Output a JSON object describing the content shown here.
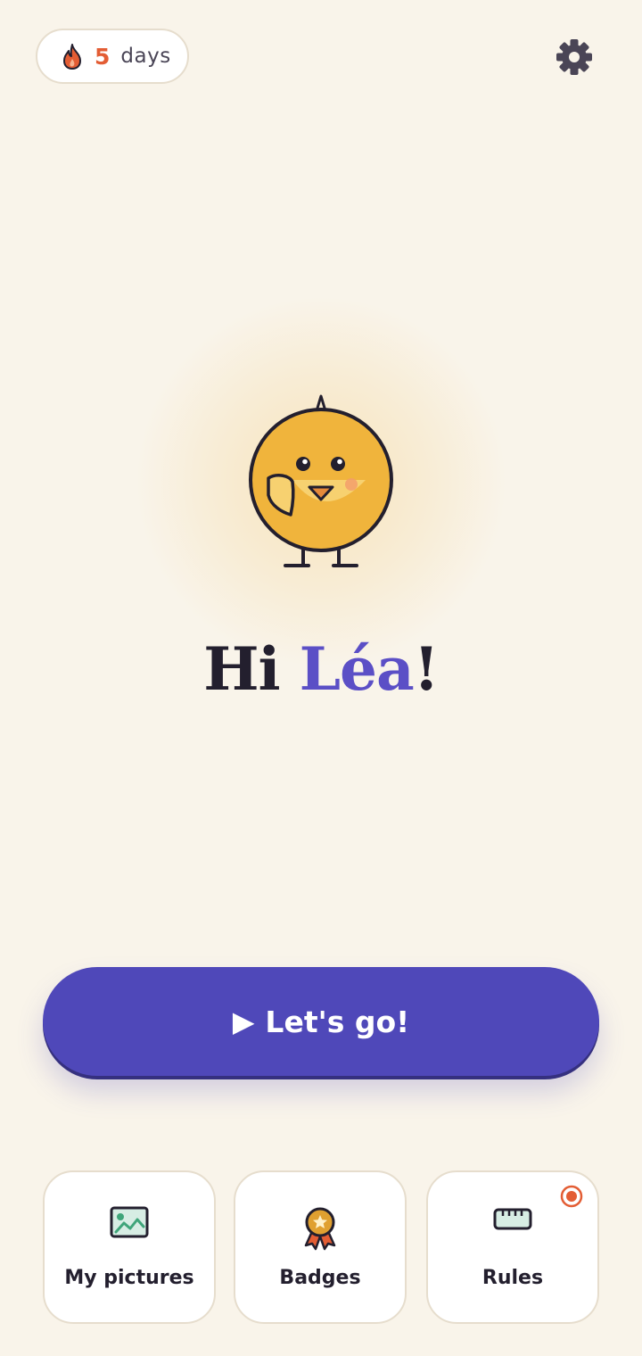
{
  "header": {
    "streak": {
      "icon": "flame-icon",
      "count": "5",
      "unit": "days"
    },
    "settings_icon": "gear-icon"
  },
  "hero": {
    "mascot": "chick-mascot",
    "greeting": {
      "prefix": "Hi",
      "name": "Léa",
      "suffix": "!"
    }
  },
  "cta": {
    "icon": "▶",
    "label": "Let's go!"
  },
  "tiles": [
    {
      "label": "My pictures",
      "icon": "image-icon"
    },
    {
      "label": "Badges",
      "icon": "badge-icon"
    },
    {
      "label": "Rules",
      "icon": "ruler-icon",
      "notification": true
    }
  ],
  "colors": {
    "background": "#f9f4ea",
    "accent": "#4f48b9",
    "name_accent": "#5b4fc6",
    "streak": "#e35d34",
    "mascot": "#f0b43c"
  }
}
